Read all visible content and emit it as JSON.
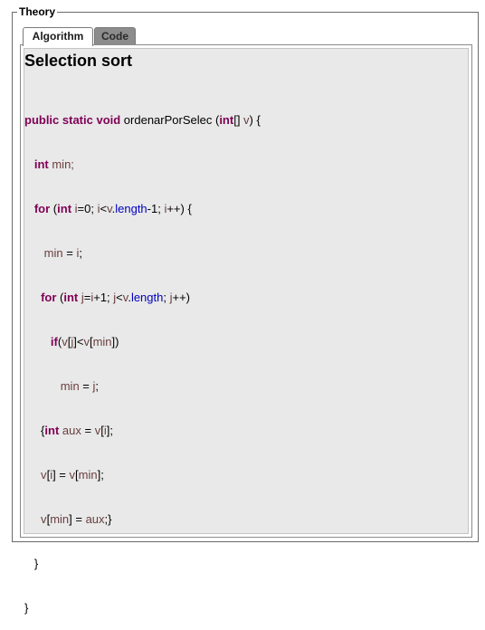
{
  "fieldset": {
    "legend": "Theory"
  },
  "tabs": [
    {
      "label": "Algorithm",
      "selected": true
    },
    {
      "label": "Code",
      "selected": false
    }
  ],
  "content": {
    "heading": "Selection sort",
    "code_lines": [
      "public static void ordenarPorSelec (int[] v) {",
      "   int min;",
      "   for (int i=0; i<v.length-1; i++) {",
      "      min = i;",
      "     for (int j=i+1; j<v.length; j++)",
      "        if(v[j]<v[min])",
      "           min = j;",
      "     {int aux = v[i];",
      "     v[i] = v[min];",
      "     v[min] = aux;}",
      "   }",
      "}"
    ]
  },
  "colors": {
    "keyword": "#7f0055",
    "variable": "#6a3e3e",
    "field": "#0000c0",
    "inactive_tab": "#8c8c8c",
    "panel_background": "#e9e9e9"
  }
}
